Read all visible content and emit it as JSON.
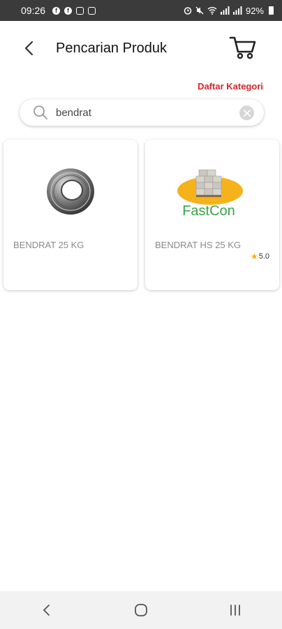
{
  "status_bar": {
    "time": "09:26",
    "battery": "92%"
  },
  "header": {
    "title": "Pencarian Produk",
    "back_icon": "chevron-left-icon",
    "cart_icon": "cart-icon"
  },
  "category_link": "Daftar Kategori",
  "search": {
    "value": "bendrat",
    "placeholder": ""
  },
  "products": [
    {
      "name": "BENDRAT 25 KG",
      "image": "wire-coil-image",
      "rating": ""
    },
    {
      "name": "BENDRAT HS 25 KG",
      "image": "fastcon-logo-image",
      "logo_text": "FastCon",
      "rating": "5.0"
    }
  ],
  "colors": {
    "accent": "#d9232d",
    "status_bar": "#3b3b3b",
    "star": "#f4b400",
    "logo_green": "#3aa34a",
    "logo_orange": "#f6b21c"
  }
}
